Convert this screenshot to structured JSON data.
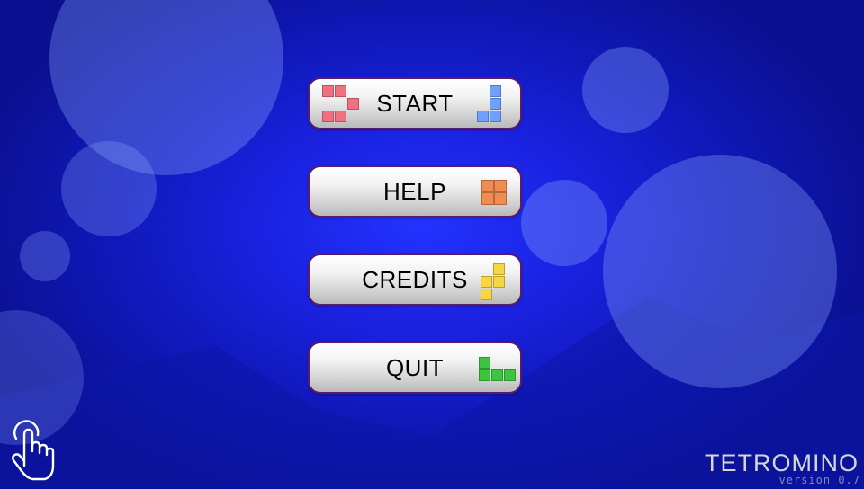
{
  "menu": {
    "buttons": [
      {
        "label": "START",
        "color": "#f07080"
      },
      {
        "label": "HELP",
        "color": "#f08c50"
      },
      {
        "label": "CREDITS",
        "color": "#f7d640"
      },
      {
        "label": "QUIT",
        "color": "#3cc640"
      }
    ],
    "start_right_color": "#6fa0ff"
  },
  "footer": {
    "title": "TETROMINO",
    "version": "version 0.7"
  },
  "icons": {
    "touch": "touch-hand-icon"
  },
  "colors": {
    "background": "#1a22e0",
    "button_border": "#5a1a6e"
  }
}
